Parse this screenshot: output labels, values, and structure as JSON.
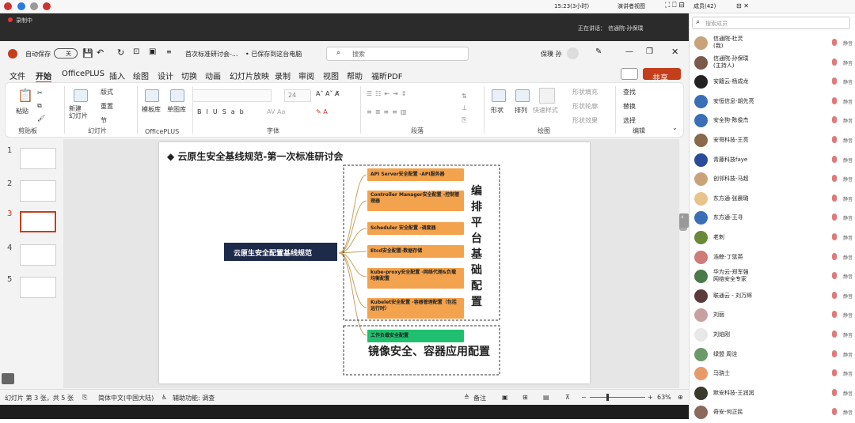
{
  "system_bar": {
    "time": "15:23(3小时)",
    "presenter_view": "演讲者视图"
  },
  "recording": {
    "label": "录制中",
    "speaking": "正在讲话：",
    "speaker": "信通院-孙保璞"
  },
  "titlebar": {
    "autosave": "自动保存",
    "toggle": "关",
    "doc_title": "首次标准研讨会-...",
    "save_status": "• 已保存到这台电脑",
    "search_placeholder": "搜索",
    "user": "保璞 孙"
  },
  "menu": [
    "文件",
    "开始",
    "OfficePLUS",
    "插入",
    "绘图",
    "设计",
    "切换",
    "动画",
    "幻灯片放映",
    "录制",
    "审阅",
    "视图",
    "帮助",
    "福昕PDF"
  ],
  "share": "共享",
  "ribbon": {
    "paste": "粘贴",
    "clipboard": "剪贴板",
    "new_slide": "新建\n幻灯片",
    "layout": "版式",
    "reset": "重置",
    "section": "节",
    "slides": "幻灯片",
    "template": "模板库",
    "single": "单图库",
    "officeplus": "OfficePLUS",
    "font_size": "24",
    "font": "字体",
    "paragraph": "段落",
    "shape": "形状",
    "arrange": "排列",
    "quick_styles": "快速样式",
    "fill": "形状填充",
    "outline": "形状轮廓",
    "effects": "形状效果",
    "drawing": "绘图",
    "find": "查找",
    "replace": "替换",
    "select": "选择",
    "editing": "编辑"
  },
  "thumbnails": [
    "1",
    "2",
    "3",
    "4",
    "5"
  ],
  "slide": {
    "title": "◆ 云原生安全基线规范-第一次标准研讨会",
    "root": "云原生安全配置基线规范",
    "nodes": [
      "API Server安全配置 -API服务器",
      "Controller Manager安全配置 -控制管理器",
      "Scheduler 安全配置 -调度器",
      "Etcd安全配置-数据存储",
      "kube-proxy安全配置 -网络代理&负载均衡配置",
      "Kubelet安全配置 -容器管理配置（包括运行时）"
    ],
    "green_node": "工作负载安全配置",
    "side_label": "编排平台基础配置",
    "bottom_label": "镜像安全、容器应用配置"
  },
  "status": {
    "slide_info": "幻灯片 第 3 张，共 5 张",
    "language": "简体中文(中国大陆)",
    "accessibility": "辅助功能: 调查",
    "notes": "备注",
    "zoom": "63%"
  },
  "members": {
    "header": "成员(42)",
    "search_placeholder": "搜索成员",
    "list": [
      {
        "name": "信通院-杜灵",
        "sub": "(我)"
      },
      {
        "name": "信通院-孙保璞",
        "sub": "(主持人)"
      },
      {
        "name": "安籍云-杨成龙",
        "sub": ""
      },
      {
        "name": "安恒信息-胡先亮",
        "sub": ""
      },
      {
        "name": "安全狗-陈俊杰",
        "sub": ""
      },
      {
        "name": "安哥科技-王亮",
        "sub": ""
      },
      {
        "name": "青藤科技faye",
        "sub": ""
      },
      {
        "name": "创邻科技-马超",
        "sub": ""
      },
      {
        "name": "东方通-张晨璐",
        "sub": ""
      },
      {
        "name": "东方通-王寻",
        "sub": ""
      },
      {
        "name": "老刺",
        "sub": ""
      },
      {
        "name": "浩鲸-丁篮英",
        "sub": ""
      },
      {
        "name": "华为云-郑军强",
        "sub": "网络安全专家"
      },
      {
        "name": "联通云 - 刘万辉",
        "sub": ""
      },
      {
        "name": "刘丽",
        "sub": ""
      },
      {
        "name": "刘焰刚",
        "sub": ""
      },
      {
        "name": "绿盟 周诠",
        "sub": ""
      },
      {
        "name": "马骁士",
        "sub": ""
      },
      {
        "name": "默安科技-王润润",
        "sub": ""
      },
      {
        "name": "奇安-何正民",
        "sub": ""
      }
    ],
    "status": "静音"
  },
  "colors": {
    "accent": "#c43e1c",
    "node": "#f3a24d",
    "green": "#1fbf6f",
    "root": "#1e2a4a"
  }
}
